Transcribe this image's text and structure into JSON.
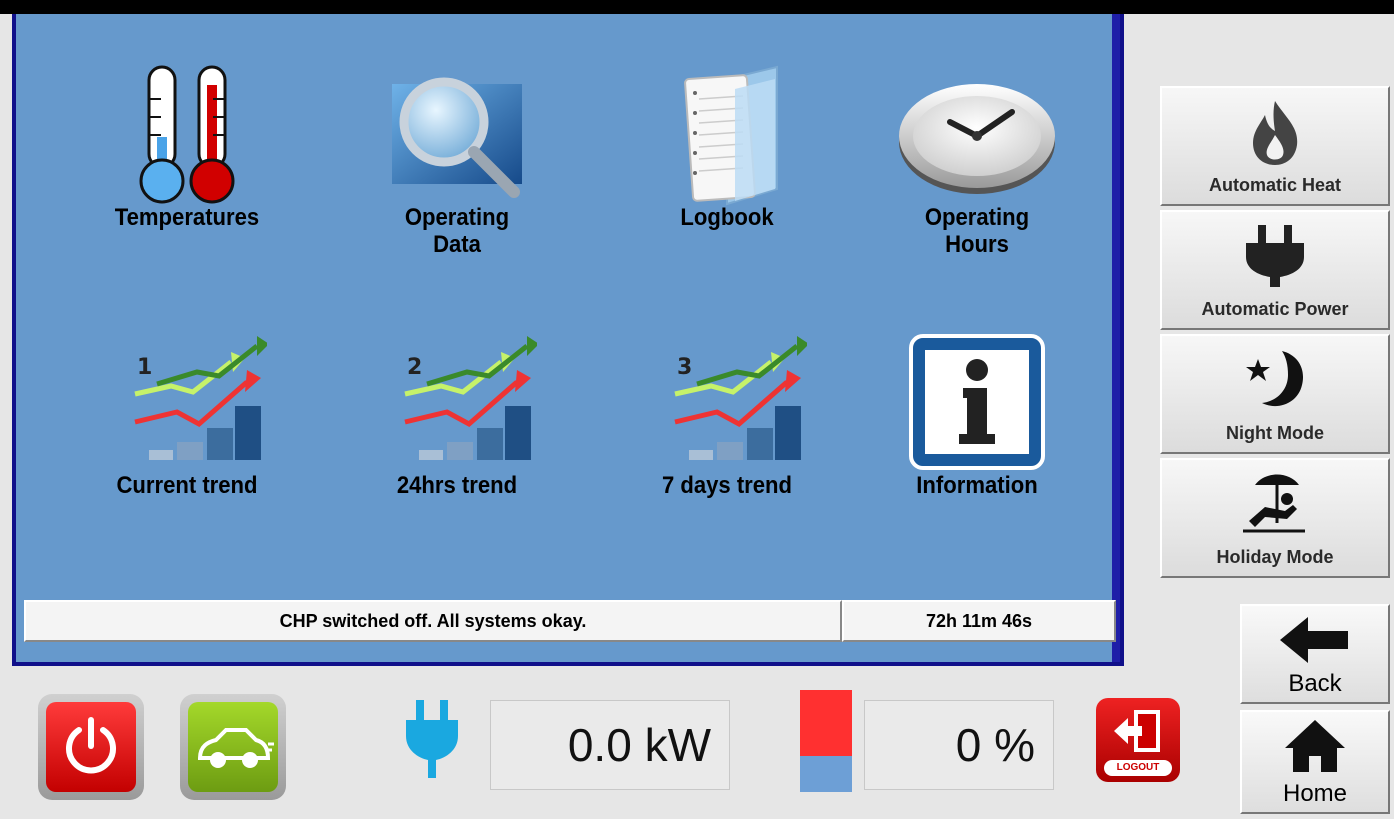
{
  "tiles": [
    {
      "label": "Temperatures",
      "icon": "thermometer-icon"
    },
    {
      "label": "Operating\nData",
      "icon": "magnifier-icon"
    },
    {
      "label": "Logbook",
      "icon": "logbook-icon"
    },
    {
      "label": "Operating\nHours",
      "icon": "clock-icon"
    },
    {
      "label": "Current trend",
      "icon": "trend-icon",
      "number": "1"
    },
    {
      "label": "24hrs trend",
      "icon": "trend-icon",
      "number": "2"
    },
    {
      "label": "7 days trend",
      "icon": "trend-icon",
      "number": "3"
    },
    {
      "label": "Information",
      "icon": "info-icon"
    }
  ],
  "status": {
    "message": "CHP switched off. All systems okay.",
    "runtime": "72h 11m 46s"
  },
  "modes": [
    {
      "label": "Automatic Heat",
      "icon": "flame-icon"
    },
    {
      "label": "Automatic Power",
      "icon": "plug-icon"
    },
    {
      "label": "Night Mode",
      "icon": "moon-icon"
    },
    {
      "label": "Holiday Mode",
      "icon": "beach-icon"
    }
  ],
  "nav": {
    "back": "Back",
    "home": "Home"
  },
  "bottom": {
    "power_value": "0.0 kW",
    "level_value": "0 %",
    "level_fraction": 0.35,
    "logout_label": "LOGOUT"
  },
  "colors": {
    "panel": "#6699cc",
    "panel_border": "#10108a",
    "power_red": "#e11",
    "ev_green": "#8fc21e"
  }
}
